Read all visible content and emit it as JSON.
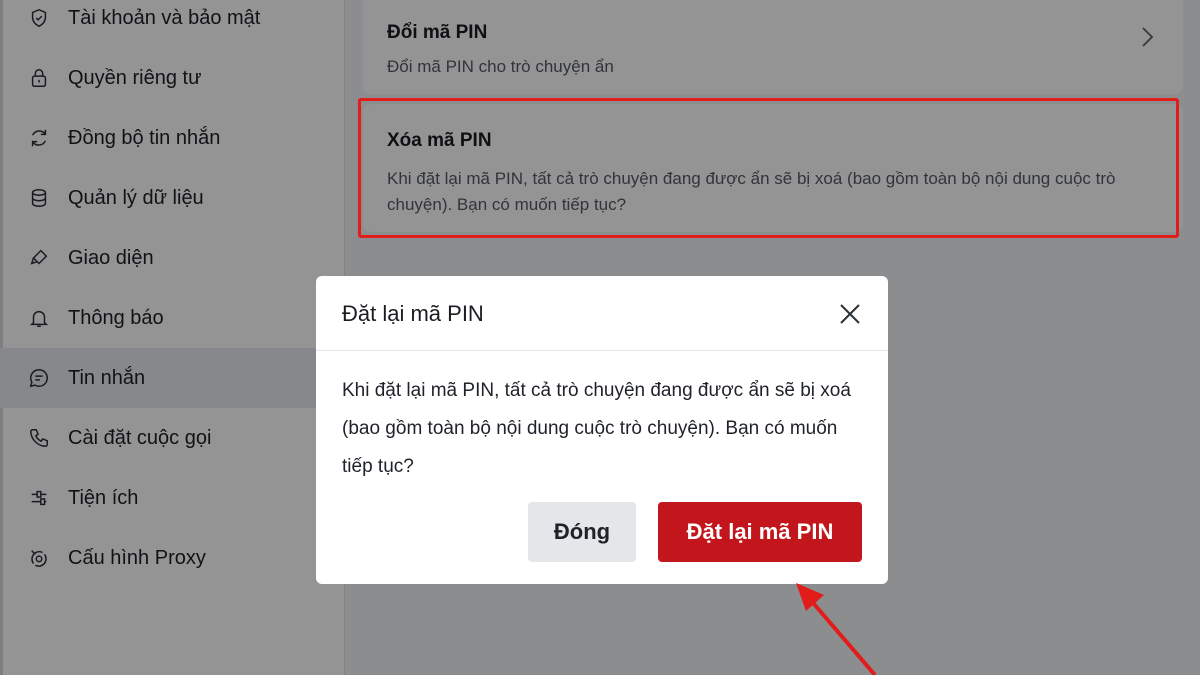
{
  "sidebar": {
    "items": [
      {
        "label": "Tài khoản và bảo mật",
        "icon": "shield-icon"
      },
      {
        "label": "Quyền riêng tư",
        "icon": "lock-icon"
      },
      {
        "label": "Đồng bộ tin nhắn",
        "icon": "sync-icon"
      },
      {
        "label": "Quản lý dữ liệu",
        "icon": "database-icon"
      },
      {
        "label": "Giao diện",
        "icon": "brush-icon"
      },
      {
        "label": "Thông báo",
        "icon": "bell-icon"
      },
      {
        "label": "Tin nhắn",
        "icon": "message-icon",
        "active": true
      },
      {
        "label": "Cài đặt cuộc gọi",
        "icon": "phone-icon"
      },
      {
        "label": "Tiện ích",
        "icon": "sliders-icon"
      },
      {
        "label": "Cấu hình Proxy",
        "icon": "proxy-icon"
      }
    ]
  },
  "main": {
    "change_pin": {
      "title": "Đổi mã PIN",
      "description": "Đổi mã PIN cho trò chuyện ẩn"
    },
    "delete_pin": {
      "title": "Xóa mã PIN",
      "description": "Khi đặt lại mã PIN, tất cả trò chuyện đang được ẩn sẽ bị xoá (bao gồm toàn bộ nội dung cuộc trò chuyện). Bạn có muốn tiếp tục?"
    }
  },
  "dialog": {
    "title": "Đặt lại mã PIN",
    "body": "Khi đặt lại mã PIN, tất cả trò chuyện đang được ẩn sẽ bị xoá (bao gồm toàn bộ nội dung cuộc trò chuyện). Bạn có muốn tiếp tục?",
    "close_label": "Đóng",
    "confirm_label": "Đặt lại mã PIN"
  },
  "colors": {
    "accent_red": "#c3161c",
    "highlight_red": "#e21b1b",
    "active_item_bg": "#e8ebf0"
  }
}
